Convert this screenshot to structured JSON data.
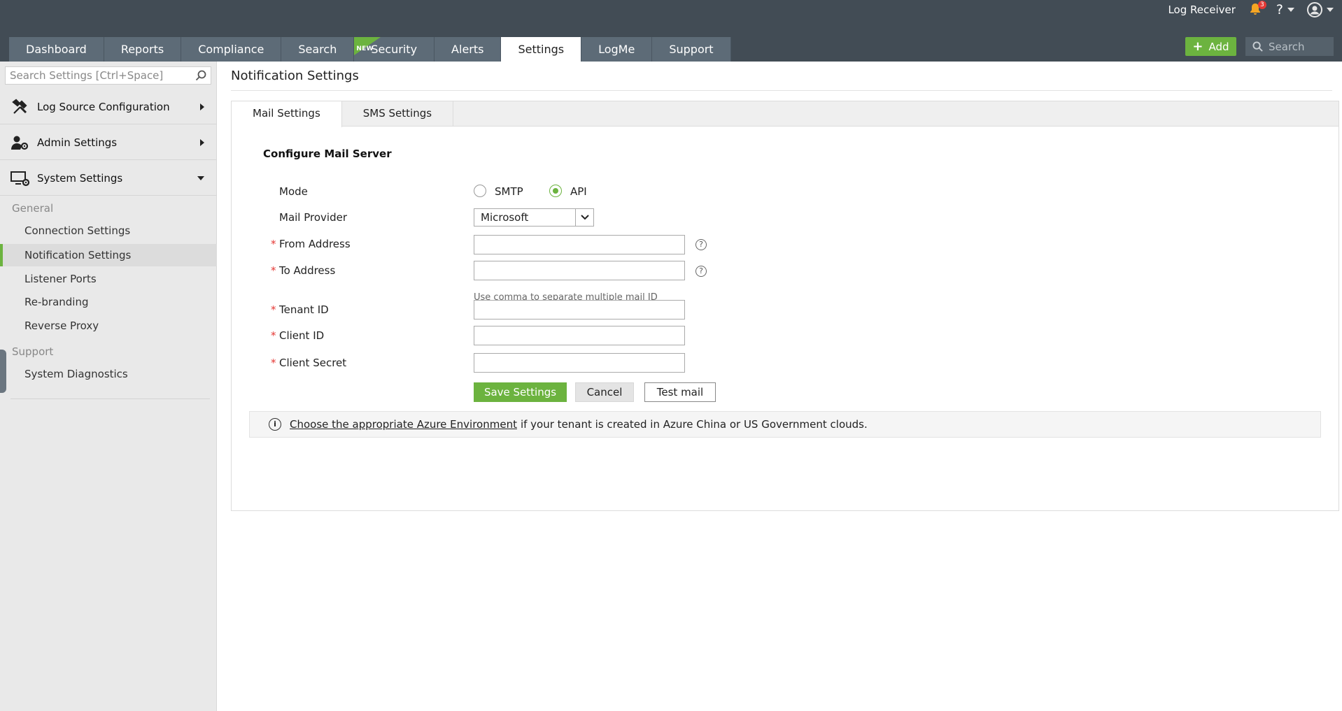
{
  "header": {
    "app_name": "Log Receiver",
    "notification_count": "3",
    "help_label": "?",
    "add_label": "Add",
    "search_placeholder": "Search"
  },
  "main_tabs": [
    {
      "label": "Dashboard"
    },
    {
      "label": "Reports"
    },
    {
      "label": "Compliance"
    },
    {
      "label": "Search"
    },
    {
      "label": "Security",
      "badge": "NEW"
    },
    {
      "label": "Alerts"
    },
    {
      "label": "Settings",
      "active": true
    },
    {
      "label": "LogMe"
    },
    {
      "label": "Support"
    }
  ],
  "sidebar": {
    "search_placeholder": "Search Settings [Ctrl+Space]",
    "sections": [
      {
        "label": "Log Source Configuration",
        "icon": "tools-icon"
      },
      {
        "label": "Admin Settings",
        "icon": "admin-user-gear-icon"
      },
      {
        "label": "System Settings",
        "icon": "monitor-gear-icon"
      }
    ],
    "groups": [
      {
        "label": "General",
        "items": [
          "Connection Settings",
          "Notification Settings",
          "Listener Ports",
          "Re-branding",
          "Reverse Proxy"
        ]
      },
      {
        "label": "Support",
        "items": [
          "System Diagnostics"
        ]
      }
    ],
    "active_item": "Notification Settings"
  },
  "page": {
    "title": "Notification Settings",
    "subtabs": [
      "Mail Settings",
      "SMS Settings"
    ],
    "section_title": "Configure Mail Server",
    "mode_label": "Mode",
    "mode_options": [
      "SMTP",
      "API"
    ],
    "mode_selected": "API",
    "mail_provider_label": "Mail Provider",
    "mail_provider_value": "Microsoft",
    "from_address_label": "From Address",
    "to_address_label": "To Address",
    "to_address_hint": "Use comma to separate multiple mail ID",
    "tenant_id_label": "Tenant ID",
    "client_id_label": "Client ID",
    "client_secret_label": "Client Secret",
    "required_mark": "*",
    "save_label": "Save Settings",
    "cancel_label": "Cancel",
    "test_label": "Test mail",
    "info_link": "Choose the appropriate Azure Environment",
    "info_text": "if your tenant is created in Azure China or US Government clouds."
  },
  "colors": {
    "topbar": "#424c55",
    "tab": "#5d6b77",
    "accent_green": "#6cb33f",
    "sidebar": "#e9e9e9",
    "badge_red": "#e53935"
  }
}
